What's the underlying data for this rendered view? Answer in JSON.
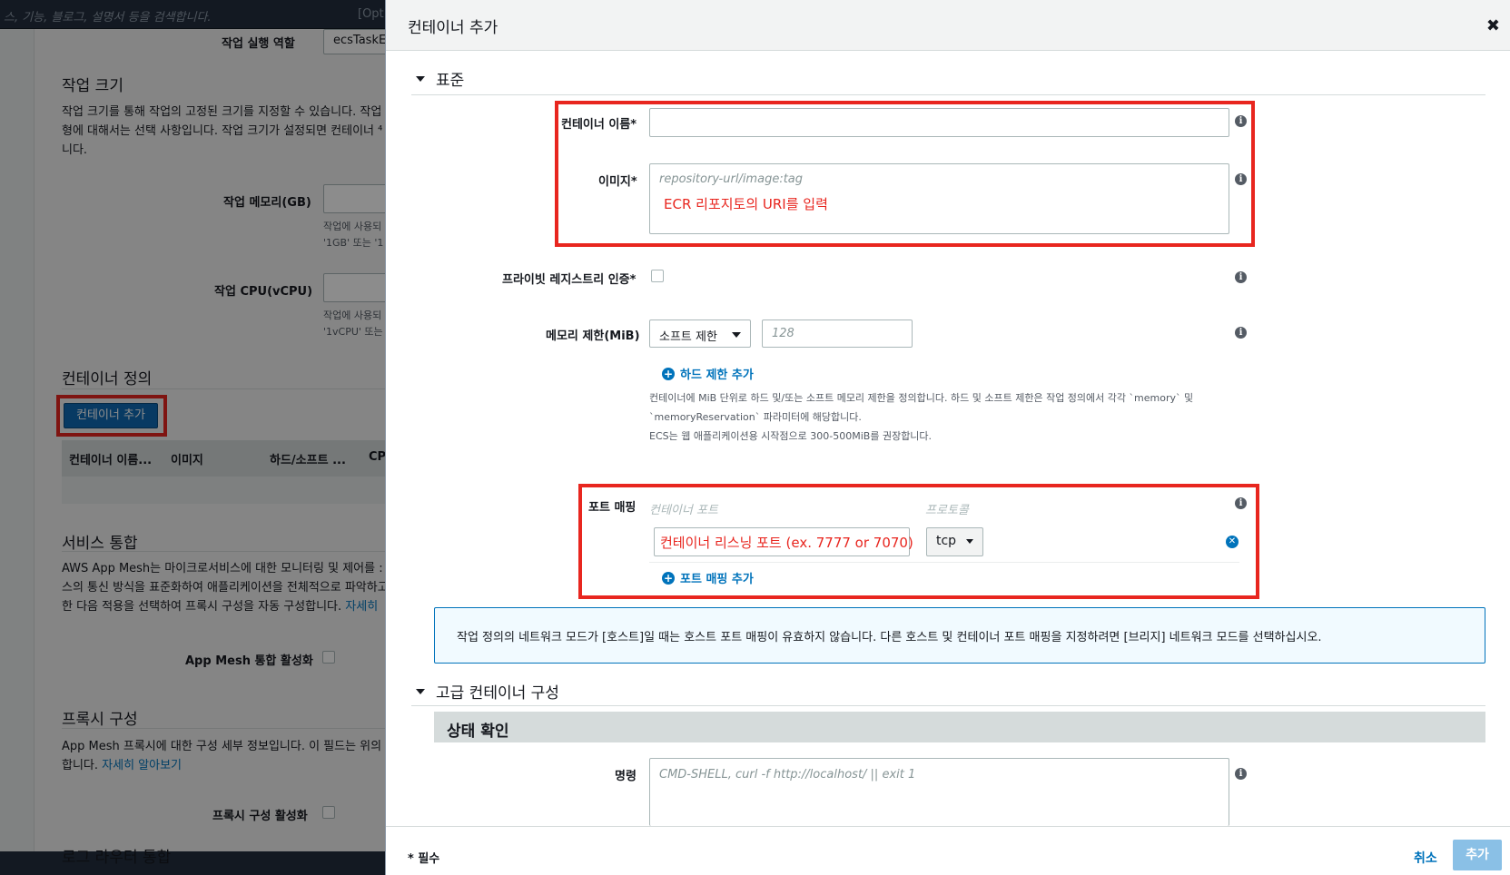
{
  "background": {
    "search_placeholder": "스, 기능, 블로그, 설명서 등을 검색합니다.",
    "search_option": "[Opt",
    "task_role_label": "작업 실행 역할",
    "task_role_value": "ecsTaskE",
    "task_size_title": "작업 크기",
    "task_size_desc_1": "작업 크기를 통해 작업의 고정된 크기를 지정할 수 있습니다. 작업",
    "task_size_desc_2": "형에 대해서는 선택 사항입니다. 작업 크기가 설정되면 컨테이너 ⁴",
    "task_size_desc_3": "니다.",
    "task_memory_label": "작업 메모리(GB)",
    "task_memory_hint_1": "작업에 사용되",
    "task_memory_hint_2": "'1GB' 또는 '1",
    "task_cpu_label": "작업 CPU(vCPU)",
    "task_cpu_hint_1": "작업에 사용되",
    "task_cpu_hint_2": "'1vCPU' 또는",
    "container_def_title": "컨테이너 정의",
    "add_container_button": "컨테이너 추가",
    "table_headers": [
      "컨테이너 이름...",
      "이미지",
      "하드/소프트 ...",
      "CP"
    ],
    "service_integration_title": "서비스 통합",
    "service_desc_1": "AWS App Mesh는 마이크로서비스에 대한 모니터링 및 제어를 :",
    "service_desc_2": "스의 통신 방식을 표준화하여 애플리케이션을 전체적으로 파악하고",
    "service_desc_3": "한 다음 적용을 선택하여 프록시 구성을 자동 구성합니다.",
    "service_desc_link": "자세히",
    "app_mesh_label": "App Mesh 통합 활성화",
    "proxy_title": "프록시 구성",
    "proxy_desc_1": "App Mesh 프록시에 대한 구성 세부 정보입니다. 이 필드는 위의",
    "proxy_desc_2": "합니다.",
    "proxy_desc_link": "자세히 알아보기",
    "proxy_enable_label": "프록시 구성 활성화",
    "log_router_title": "로그 라우터 통합"
  },
  "modal": {
    "title": "컨테이너 추가",
    "close_symbol": "✖",
    "standard_section": "표준",
    "container_name_label": "컨테이너 이름*",
    "container_name_value": "",
    "image_label": "이미지*",
    "image_placeholder": "repository-url/image:tag",
    "image_annotation": "ECR 리포지토의 URI를 입력",
    "private_registry_label": "프라이빗 레지스트리 인증*",
    "memory_limit_label": "메모리 제한(MiB)",
    "memory_limit_type": "소프트 제한",
    "memory_limit_placeholder": "128",
    "add_hard_limit": "하드 제한 추가",
    "memory_hint_1": "컨테이너에 MiB 단위로 하드 및/또는 소프트 메모리 제한을 정의합니다. 하드 및 소프트 제한은 작업 정의에서 각각 `memory` 및",
    "memory_hint_2": "`memoryReservation` 파라미터에 해당합니다.",
    "memory_hint_3": "ECS는 웹 애플리케이션용 시작점으로 300-500MiB를 권장합니다.",
    "port_mapping_label": "포트 매핑",
    "container_port_header": "컨테이너 포트",
    "protocol_header": "프로토콜",
    "port_annotation": "컨테이너 리스닝 포트 (ex. 7777 or 7070)",
    "protocol_value": "tcp",
    "add_port_mapping": "포트 매핑 추가",
    "notice_text": "작업 정의의 네트워크 모드가 [호스트]일 때는 호스트 포트 매핑이 유효하지 않습니다. 다른 호스트 및 컨테이너 포트 매핑을 지정하려면 [브리지] 네트워크 모드를 선택하십시오.",
    "advanced_section": "고급 컨테이너 구성",
    "health_check_title": "상태 확인",
    "command_label": "명령",
    "command_placeholder": "CMD-SHELL, curl -f http://localhost/ || exit 1",
    "required_note": "* 필수",
    "cancel_button": "취소",
    "add_button": "추가"
  },
  "icons": {
    "info": "info-icon",
    "plus": "plus-circle-icon",
    "remove": "remove-circle-icon",
    "close": "close-icon"
  },
  "colors": {
    "annotation_red": "#e8261f",
    "link_blue": "#0073bb",
    "primary_button": "#0f6bb5"
  }
}
